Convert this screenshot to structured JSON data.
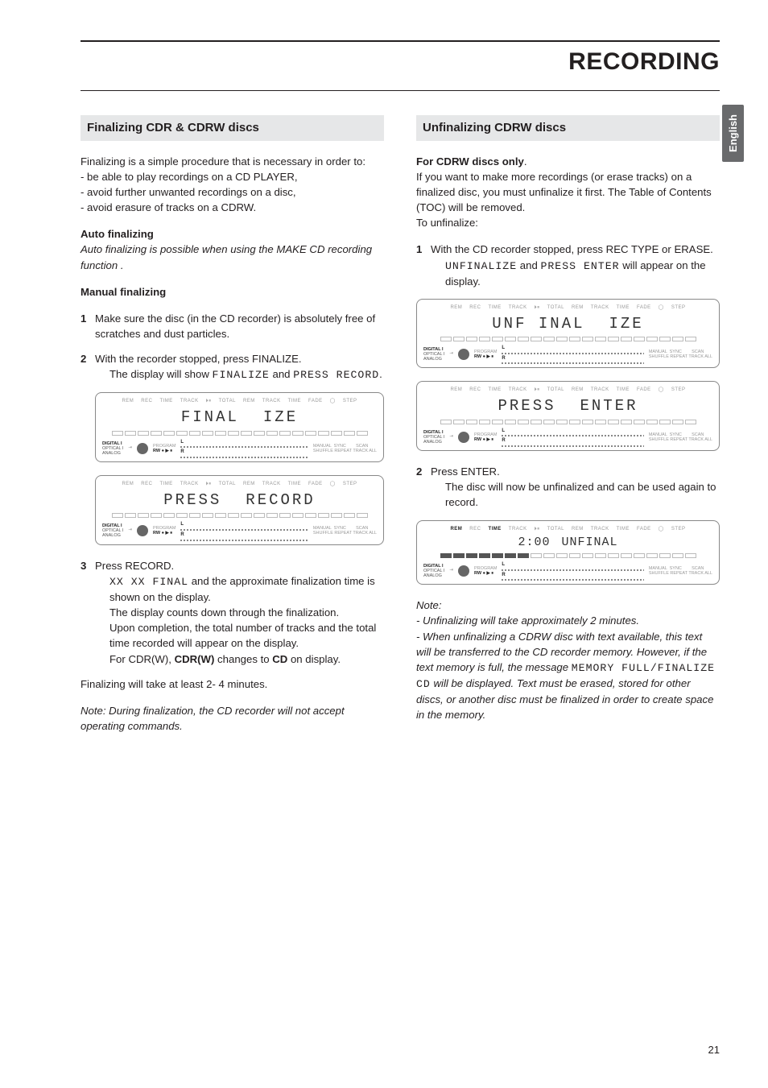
{
  "title": "RECORDING",
  "side_tab": "English",
  "page_number": "21",
  "left": {
    "section_title": "Finalizing CDR & CDRW discs",
    "intro": "Finalizing is a simple procedure that is necessary in order to:",
    "bullets": [
      "- be able to play recordings on a CD PLAYER,",
      "- avoid further unwanted recordings on a disc,",
      "- avoid erasure of tracks on a CDRW."
    ],
    "auto_heading": "Auto finalizing",
    "auto_text": "Auto finalizing is possible when using the MAKE CD recording function .",
    "manual_heading": "Manual finalizing",
    "step1": "Make sure the disc (in the CD recorder) is absolutely free of scratches and dust particles.",
    "step2_a": "With the recorder stopped, press FINALIZE.",
    "step2_b_prefix": "The display will show ",
    "step2_b_seg1": "FINALIZE",
    "step2_b_mid": " and ",
    "step2_b_seg2": "PRESS RECORD",
    "step2_b_suffix": ".",
    "disp1_main_a": "FINAL",
    "disp1_main_b": "IZE",
    "disp2_main_a": "PRESS",
    "disp2_main_b": "RECORD",
    "step3_a": "Press RECORD.",
    "step3_seg": "XX XX FINAL",
    "step3_b": " and the approximate finalization time is shown on the display.",
    "step3_c": "The display counts down through the finalization.",
    "step3_d": "Upon completion, the total number of tracks and the total time recorded will appear on the display.",
    "step3_e_prefix": "For CDR(W), ",
    "step3_e_bold1": "CDR(W)",
    "step3_e_mid": " changes to ",
    "step3_e_bold2": "CD",
    "step3_e_suffix": " on display.",
    "closing": "Finalizing will take at least 2- 4 minutes.",
    "note": "Note: During finalization, the CD recorder will not accept operating  commands."
  },
  "right": {
    "section_title": "Unfinalizing CDRW discs",
    "sub_heading": "For CDRW discs only",
    "para1": "If you want to make more recordings (or erase tracks) on a finalized disc, you must unfinalize it first. The Table of Contents (TOC) will be removed.",
    "para2": "To unfinalize:",
    "step1_a": "With the CD recorder stopped, press REC TYPE or ERASE.",
    "step1_seg1": "UNFINALIZE",
    "step1_mid": " and ",
    "step1_seg2": "PRESS ENTER",
    "step1_suffix": " will appear on the display.",
    "disp1_a": "UNF INAL",
    "disp1_b": "IZE",
    "disp2_a": "PRESS",
    "disp2_b": "ENTER",
    "step2_a": "Press ENTER.",
    "step2_b": "The disc will now be unfinalized and can be used again to record.",
    "disp3_a": "2:00",
    "disp3_b": "UNFINAL",
    "note_head": "Note:",
    "note1": "- Unfinalizing will take approximately 2 minutes.",
    "note2_a": "- When unfinalizing a CDRW disc with text available, this text will be transferred to the CD recorder memory. However, if the text memory is full,  the message ",
    "note2_seg": "MEMORY FULL/FINALIZE CD",
    "note2_b": " will be displayed. Text must be erased, stored for other discs, or another disc must be finalized in order to create space in the memory."
  },
  "disp_labels": {
    "top": [
      "REM",
      "REC",
      "TIME",
      "TRACK",
      "⏵⏸",
      "TOTAL",
      "REM",
      "TRACK",
      "TIME",
      "FADE",
      "◯",
      "STEP"
    ],
    "bottom_left": "DIGITAL I\nOPTICAL I\nANALOG",
    "bottom_prog": "PROGRAM",
    "bottom_rw": "RW ● ▶ ⏸",
    "bottom_right": "MANUAL  SYNC        SCAN\nSHUFFLE REPEAT TRACK ALL"
  }
}
